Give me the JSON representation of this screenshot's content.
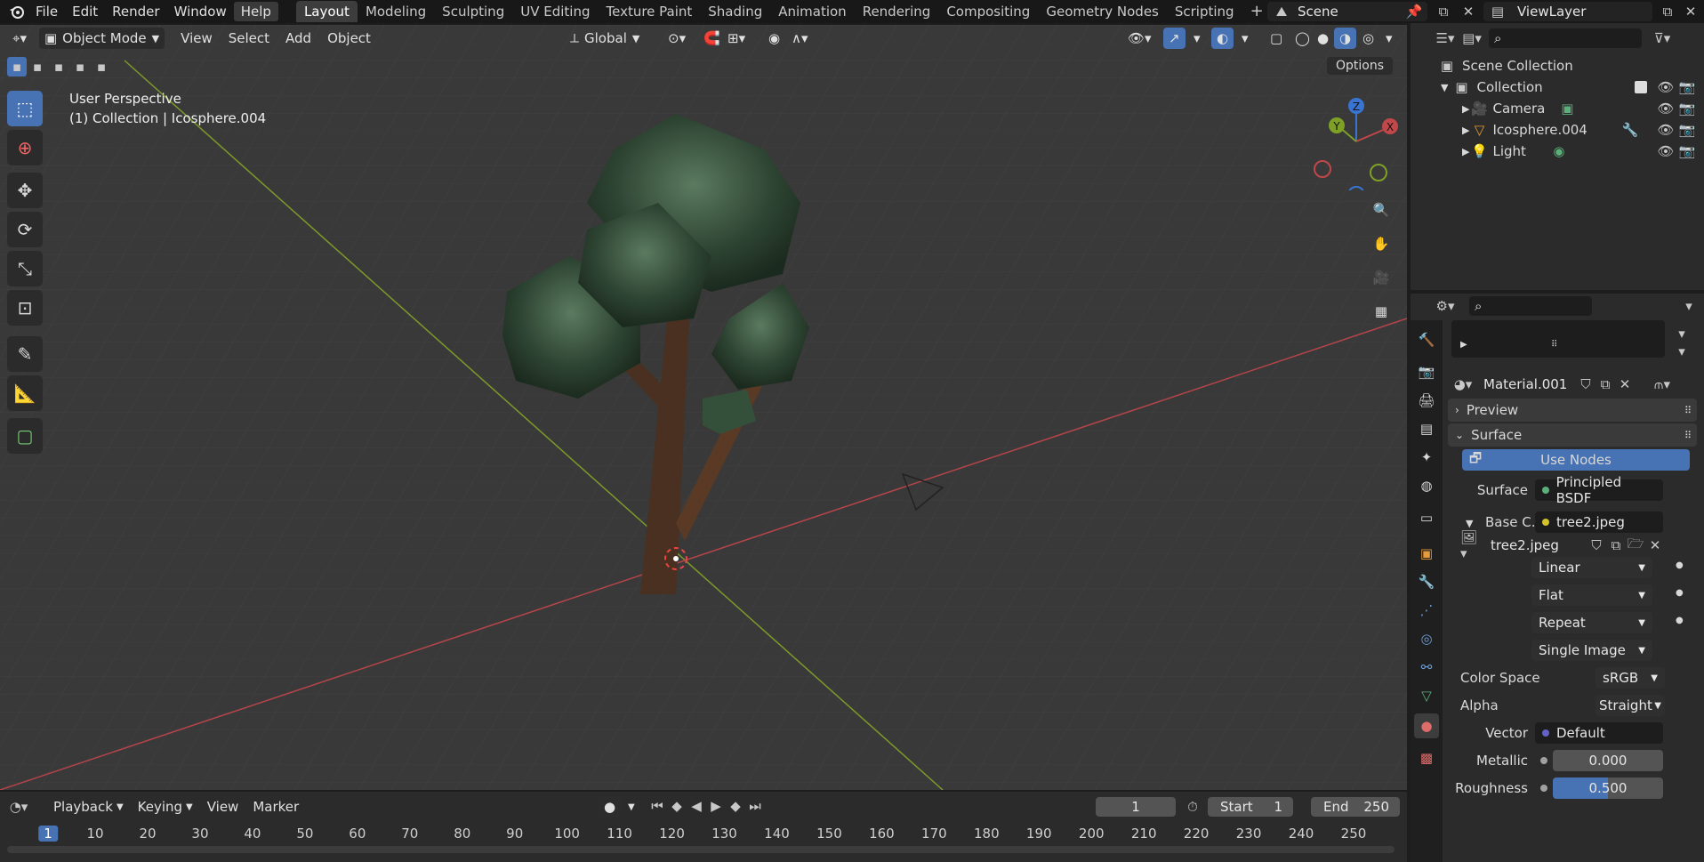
{
  "topbar": {
    "menus": [
      "File",
      "Edit",
      "Render",
      "Window",
      "Help"
    ],
    "workspaces": [
      "Layout",
      "Modeling",
      "Sculpting",
      "UV Editing",
      "Texture Paint",
      "Shading",
      "Animation",
      "Rendering",
      "Compositing",
      "Geometry Nodes",
      "Scripting"
    ],
    "add_tab": "+",
    "scene": "Scene",
    "view_layer": "ViewLayer"
  },
  "viewport": {
    "mode": "Object Mode",
    "menus": [
      "View",
      "Select",
      "Add",
      "Object"
    ],
    "transform_orientation": "Global",
    "options": "Options",
    "perspective": "User Perspective",
    "context": "(1) Collection | Icosphere.004",
    "gizmo": {
      "x": "X",
      "y": "Y",
      "z": "Z"
    }
  },
  "outliner": {
    "root": "Scene Collection",
    "collection": "Collection",
    "items": [
      "Camera",
      "Icosphere.004",
      "Light"
    ]
  },
  "properties": {
    "material": "Material.001",
    "preview": "Preview",
    "surface_panel": "Surface",
    "use_nodes": "Use Nodes",
    "surface_label": "Surface",
    "surface_value": "Principled BSDF",
    "base_color_label": "Base C...",
    "base_color_value": "tree2.jpeg",
    "image_name": "tree2.jpeg",
    "interpolation": "Linear",
    "projection": "Flat",
    "extension": "Repeat",
    "source": "Single Image",
    "color_space_label": "Color Space",
    "color_space": "sRGB",
    "alpha_label": "Alpha",
    "alpha": "Straight",
    "vector_label": "Vector",
    "vector": "Default",
    "metallic_label": "Metallic",
    "metallic": "0.000",
    "roughness_label": "Roughness",
    "roughness": "0.500",
    "roughness_fraction": 0.5
  },
  "timeline": {
    "menus": [
      "Playback",
      "Keying",
      "View",
      "Marker"
    ],
    "current_frame": "1",
    "start_label": "Start",
    "start": "1",
    "end_label": "End",
    "end": "250",
    "ticks": [
      "1",
      "10",
      "20",
      "30",
      "40",
      "50",
      "60",
      "70",
      "80",
      "90",
      "100",
      "110",
      "120",
      "130",
      "140",
      "150",
      "160",
      "170",
      "180",
      "190",
      "200",
      "210",
      "220",
      "230",
      "240",
      "250"
    ]
  },
  "colors": {
    "accent": "#4772b3",
    "x_axis": "#c0474a",
    "y_axis": "#7ea027",
    "z_axis": "#3a74d1"
  }
}
